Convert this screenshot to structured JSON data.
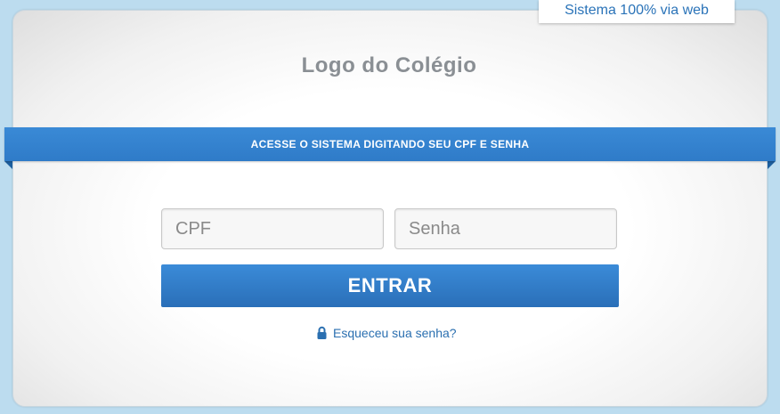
{
  "badge": {
    "text": "Sistema 100% via web"
  },
  "logo": {
    "text": "Logo do Colégio"
  },
  "banner": {
    "text": "ACESSE O SISTEMA DIGITANDO SEU CPF E SENHA"
  },
  "form": {
    "cpf_placeholder": "CPF",
    "cpf_value": "",
    "password_placeholder": "Senha",
    "password_value": "",
    "submit_label": "ENTRAR",
    "forgot_label": "Esqueceu sua senha?",
    "forgot_icon": "lock-icon"
  },
  "colors": {
    "background": "#bcdcef",
    "accent": "#2f7bc8",
    "link": "#2a6fb0",
    "logo_text": "#8a8f94"
  }
}
